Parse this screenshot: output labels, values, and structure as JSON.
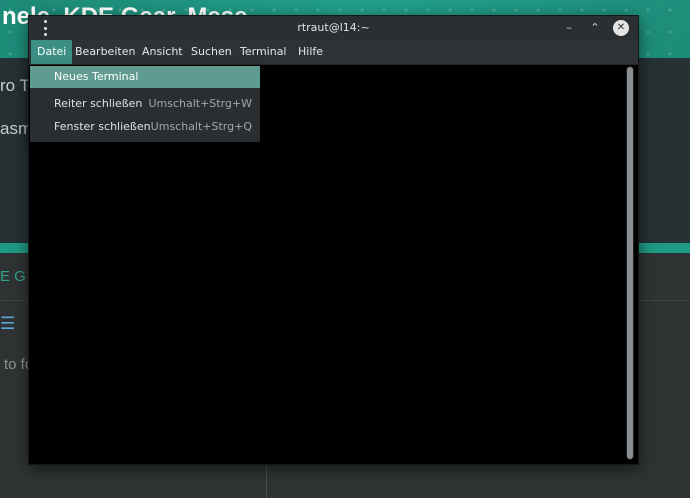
{
  "background_page": {
    "heading": "nele, KDE Gear, Mese",
    "text_line1": "ro T",
    "text_line2": "asma",
    "tab_label": "E G",
    "menu_icon": "hamburger-menu-icon",
    "text_line3": "to fo"
  },
  "window": {
    "title": "rtraut@l14:~",
    "menu_icon": "kebab-menu-icon",
    "controls": {
      "minimize_glyph": "–",
      "maximize_glyph": "⌃",
      "close_glyph": "✕"
    },
    "menubar": [
      "Datei",
      "Bearbeiten",
      "Ansicht",
      "Suchen",
      "Terminal",
      "Hilfe"
    ],
    "active_menu": "Datei"
  },
  "dropdown": {
    "items": [
      {
        "label": "Neues Terminal",
        "shortcut": ""
      },
      {
        "label": "Reiter schließen",
        "shortcut": "Umschalt+Strg+W"
      },
      {
        "label": "Fenster schließen",
        "shortcut": "Umschalt+Strg+Q"
      }
    ]
  },
  "colors": {
    "accent": "#3c8f84",
    "highlight": "#5f9b90",
    "banner": "#1f8f7c"
  }
}
